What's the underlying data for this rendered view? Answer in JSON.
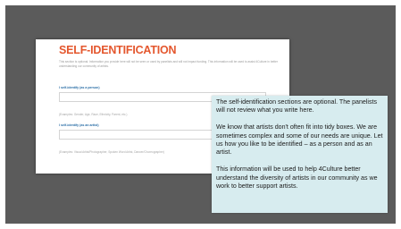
{
  "form": {
    "title": "SELF-IDENTIFICATION",
    "intro": "This section is optional. Information you provide here will not be seen or used by panelists and will not impact funding. This information will be used to assist 4Culture in better understanding our community of artists.",
    "questions": [
      {
        "label": "I self-identify (as a person)",
        "value": "",
        "example": "(Examples: Gender, Age, Race, Ethnicity, Parent, etc.)"
      },
      {
        "label": "I self-identify (as an artist)",
        "value": "",
        "example": "(Examples: Visual Artist/Photographer, Spoken Word Artist, Dancer/Choreographer)"
      }
    ]
  },
  "note": {
    "paragraphs": [
      "The self-identification sections are optional. The panelists will not review what you write here.",
      "We know that artists don't often fit into tidy boxes. We are sometimes complex and some of our needs are unique. Let us how you like to be identified – as a person and as an artist.",
      "This information will be used to help 4Culture better understand the diversity of artists in our community as we work to better support artists."
    ]
  },
  "colors": {
    "background": "#5b5b5b",
    "title": "#e4572e",
    "question_label": "#2a6ea6",
    "note_background": "#d7ecef"
  }
}
